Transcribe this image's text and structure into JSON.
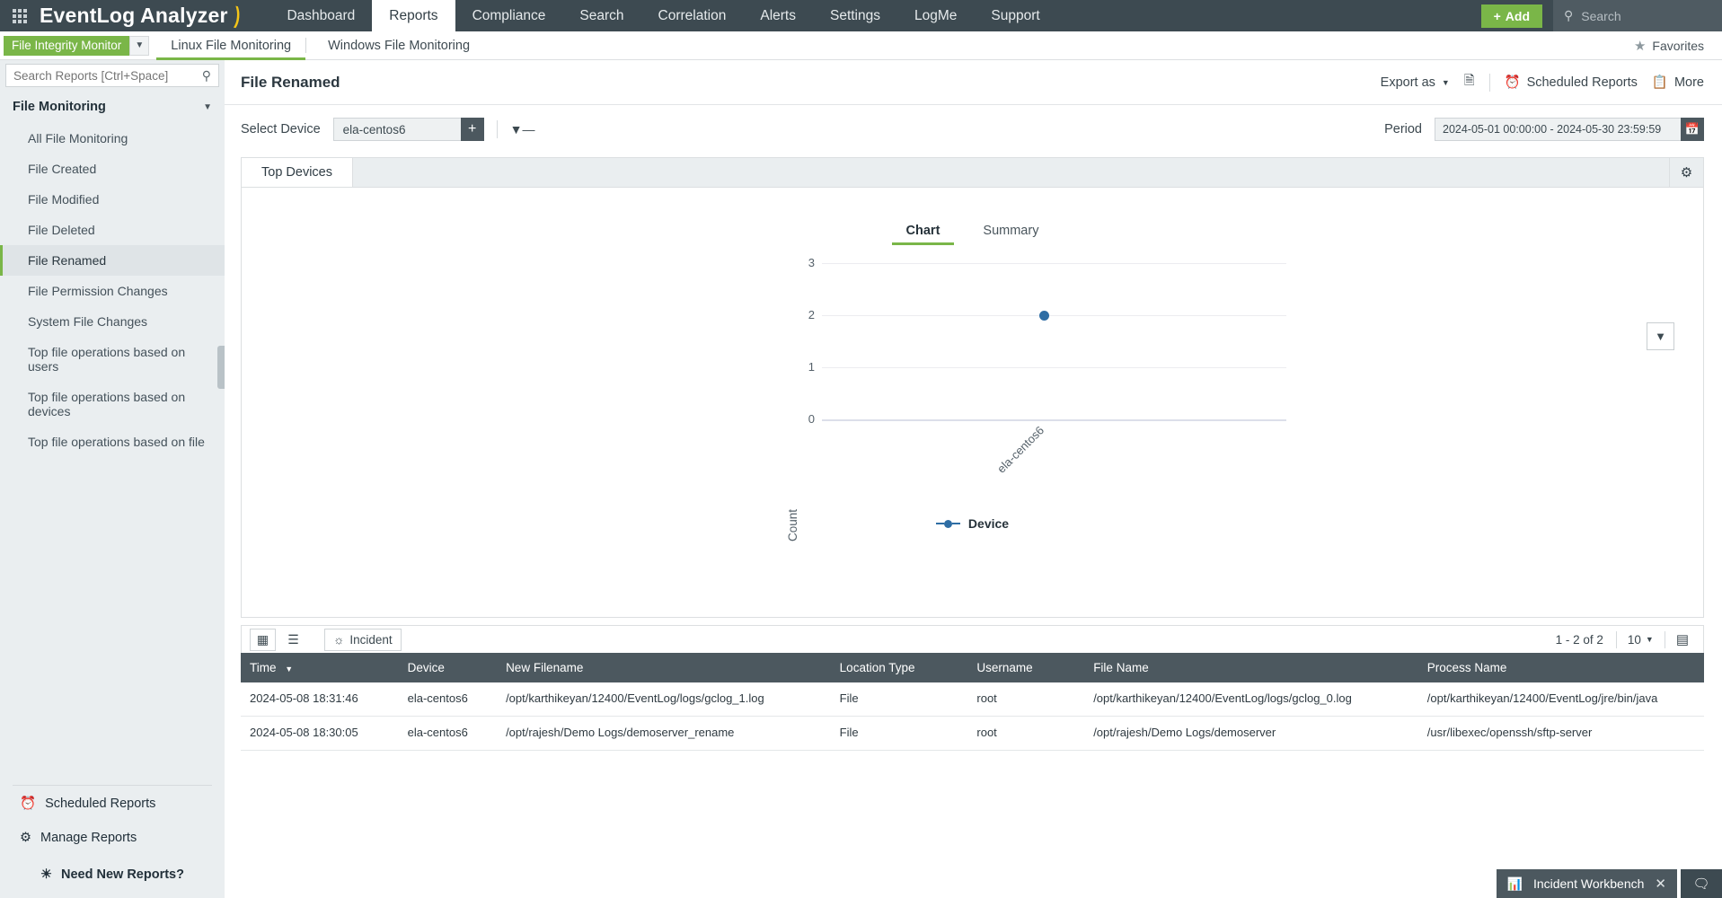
{
  "app": {
    "brand": "EventLog Analyzer",
    "grid_icon": "apps-grid-icon"
  },
  "topnav": {
    "items": [
      {
        "label": "Dashboard",
        "active": false
      },
      {
        "label": "Reports",
        "active": true
      },
      {
        "label": "Compliance",
        "active": false
      },
      {
        "label": "Search",
        "active": false
      },
      {
        "label": "Correlation",
        "active": false
      },
      {
        "label": "Alerts",
        "active": false
      },
      {
        "label": "Settings",
        "active": false
      },
      {
        "label": "LogMe",
        "active": false
      },
      {
        "label": "Support",
        "active": false
      }
    ],
    "add_label": "Add",
    "add_color": "#7ab648",
    "search_placeholder": "Search"
  },
  "subnav": {
    "module_chip": "File Integrity Monitor",
    "tabs": [
      {
        "label": "Linux File Monitoring",
        "active": true
      },
      {
        "label": "Windows File Monitoring",
        "active": false
      }
    ],
    "favorites_label": "Favorites"
  },
  "sidebar": {
    "search_placeholder": "Search Reports [Ctrl+Space]",
    "group_label": "File Monitoring",
    "items": [
      {
        "label": "All File Monitoring",
        "active": false
      },
      {
        "label": "File Created",
        "active": false
      },
      {
        "label": "File Modified",
        "active": false
      },
      {
        "label": "File Deleted",
        "active": false
      },
      {
        "label": "File Renamed",
        "active": true
      },
      {
        "label": "File Permission Changes",
        "active": false
      },
      {
        "label": "System File Changes",
        "active": false
      },
      {
        "label": "Top file operations based on users",
        "active": false
      },
      {
        "label": "Top file operations based on devices",
        "active": false
      },
      {
        "label": "Top file operations based on file",
        "active": false
      }
    ],
    "bottom": [
      {
        "label": "Scheduled Reports",
        "icon": "alarm-clock-icon"
      },
      {
        "label": "Manage Reports",
        "icon": "gear-icon"
      }
    ],
    "need_reports": "Need New Reports?"
  },
  "report": {
    "title": "File Renamed",
    "tools": [
      {
        "label": "Export as",
        "icon": "chevron-down-icon"
      },
      {
        "label": "",
        "icon": "export-doc-icon"
      },
      {
        "label": "Scheduled Reports",
        "icon": "alarm-clock-icon"
      },
      {
        "label": "More",
        "icon": "more-icon"
      }
    ]
  },
  "filters": {
    "device_label": "Select Device",
    "device_value": "ela-centos6",
    "add_device_icon": "plus-icon",
    "funnel_icon": "filter-icon",
    "period_label": "Period",
    "period_value": "2024-05-01 00:00:00 - 2024-05-30 23:59:59",
    "calendar_icon": "calendar-icon"
  },
  "panel": {
    "tab_label": "Top Devices",
    "gear_icon": "gear-icon",
    "chart_tabs": [
      {
        "label": "Chart",
        "active": true
      },
      {
        "label": "Summary",
        "active": false
      }
    ],
    "dropdown_icon": "chevron-down-icon"
  },
  "chart_data": {
    "type": "scatter",
    "title": "",
    "categories": [
      "ela-centos6"
    ],
    "values": [
      2
    ],
    "series": [
      {
        "name": "Device",
        "values": [
          2
        ]
      }
    ],
    "xlabel": "",
    "ylabel": "Count",
    "ylim": [
      0,
      3
    ],
    "yticks": [
      "3",
      "2",
      "1",
      "0"
    ],
    "grid": true,
    "legend": [
      "Device"
    ],
    "legend_position": "bottom",
    "point_color": "#2e6da4"
  },
  "table": {
    "view_grid_icon": "table-view-icon",
    "view_list_icon": "list-view-icon",
    "incident_label": "Incident",
    "incident_icon": "fingerprint-icon",
    "page_range": "1 - 2 of 2",
    "page_size": "10",
    "column_config_icon": "column-config-icon",
    "columns": [
      "Time",
      "Device",
      "New Filename",
      "Location Type",
      "Username",
      "File Name",
      "Process Name"
    ],
    "sort_column": "Time",
    "rows": [
      {
        "time": "2024-05-08 18:31:46",
        "device": "ela-centos6",
        "new_filename": "/opt/karthikeyan/12400/EventLog/logs/gclog_1.log",
        "location_type": "File",
        "username": "root",
        "file_name": "/opt/karthikeyan/12400/EventLog/logs/gclog_0.log",
        "process_name": "/opt/karthikeyan/12400/EventLog/jre/bin/java"
      },
      {
        "time": "2024-05-08 18:30:05",
        "device": "ela-centos6",
        "new_filename": "/opt/rajesh/Demo Logs/demoserver_rename",
        "location_type": "File",
        "username": "root",
        "file_name": "/opt/rajesh/Demo Logs/demoserver",
        "process_name": "/usr/libexec/openssh/sftp-server"
      }
    ]
  },
  "footer": {
    "workbench_label": "Incident Workbench",
    "workbench_icon": "workbench-icon",
    "close_icon": "close-icon",
    "chat_icon": "chat-icon"
  }
}
